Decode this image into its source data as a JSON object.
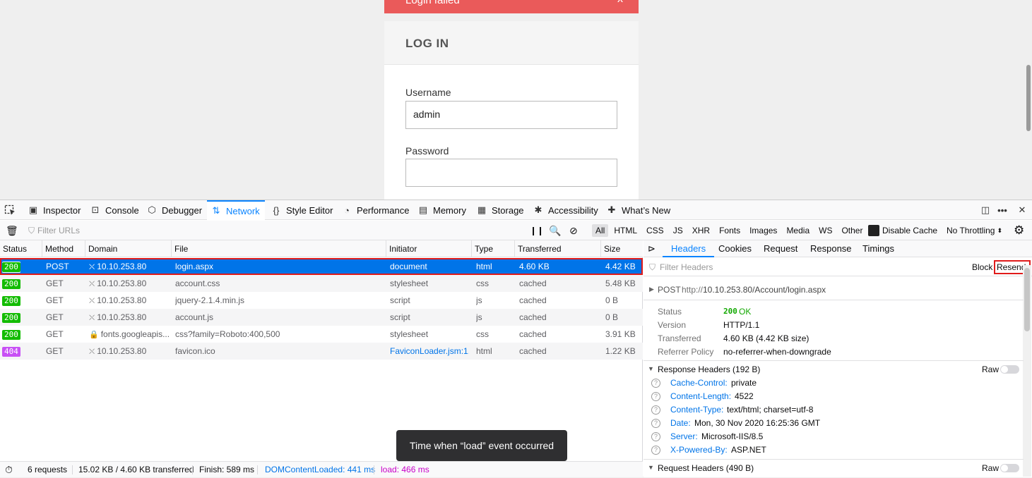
{
  "page": {
    "alert_text": "Login failed",
    "alert_close": "x",
    "login_title": "LOG IN",
    "username_label": "Username",
    "username_value": "admin",
    "password_label": "Password",
    "password_value": ""
  },
  "devtools": {
    "tabs": [
      "Inspector",
      "Console",
      "Debugger",
      "Network",
      "Style Editor",
      "Performance",
      "Memory",
      "Storage",
      "Accessibility",
      "What’s New"
    ],
    "active_tab": "Network",
    "filter_placeholder": "Filter URLs",
    "type_filters": [
      "All",
      "HTML",
      "CSS",
      "JS",
      "XHR",
      "Fonts",
      "Images",
      "Media",
      "WS",
      "Other"
    ],
    "disable_cache": "Disable Cache",
    "throttling": "No Throttling",
    "columns": [
      "Status",
      "Method",
      "Domain",
      "File",
      "Initiator",
      "Type",
      "Transferred",
      "Size"
    ],
    "requests": [
      {
        "status": "200",
        "method": "POST",
        "domain": "10.10.253.80",
        "file": "login.aspx",
        "initiator": "document",
        "type": "html",
        "transferred": "4.60 KB",
        "size": "4.42 KB"
      },
      {
        "status": "200",
        "method": "GET",
        "domain": "10.10.253.80",
        "file": "account.css",
        "initiator": "stylesheet",
        "type": "css",
        "transferred": "cached",
        "size": "5.48 KB"
      },
      {
        "status": "200",
        "method": "GET",
        "domain": "10.10.253.80",
        "file": "jquery-2.1.4.min.js",
        "initiator": "script",
        "type": "js",
        "transferred": "cached",
        "size": "0 B"
      },
      {
        "status": "200",
        "method": "GET",
        "domain": "10.10.253.80",
        "file": "account.js",
        "initiator": "script",
        "type": "js",
        "transferred": "cached",
        "size": "0 B"
      },
      {
        "status": "200",
        "method": "GET",
        "domain": "fonts.googleapis...",
        "file": "css?family=Roboto:400,500",
        "initiator": "stylesheet",
        "type": "css",
        "transferred": "cached",
        "size": "3.91 KB"
      },
      {
        "status": "404",
        "method": "GET",
        "domain": "10.10.253.80",
        "file": "favicon.ico",
        "initiator": "FaviconLoader.jsm:1...",
        "type": "html",
        "transferred": "cached",
        "size": "1.22 KB"
      }
    ],
    "tooltip": "Time when “load” event occurred",
    "statusbar": {
      "requests": "6 requests",
      "transferred": "15.02 KB / 4.60 KB transferred",
      "finish": "Finish: 589 ms",
      "dcl": "DOMContentLoaded: 441 ms",
      "load": "load: 466 ms"
    },
    "side": {
      "tabs": [
        "Headers",
        "Cookies",
        "Request",
        "Response",
        "Timings"
      ],
      "active_tab": "Headers",
      "filter_placeholder": "Filter Headers",
      "block": "Block",
      "resend": "Resend",
      "summary_method": "POST",
      "summary_url_scheme": "http://",
      "summary_url_rest": "10.10.253.80/Account/login.aspx",
      "status_label": "Status",
      "status_code": "200",
      "status_text": "OK",
      "version_label": "Version",
      "version_value": "HTTP/1.1",
      "transferred_label": "Transferred",
      "transferred_value": "4.60 KB (4.42 KB size)",
      "referrer_label": "Referrer Policy",
      "referrer_value": "no-referrer-when-downgrade",
      "response_headers_title": "Response Headers (192 B)",
      "raw": "Raw",
      "response_headers": [
        {
          "name": "Cache-Control:",
          "value": "private"
        },
        {
          "name": "Content-Length:",
          "value": "4522"
        },
        {
          "name": "Content-Type:",
          "value": "text/html; charset=utf-8"
        },
        {
          "name": "Date:",
          "value": "Mon, 30 Nov 2020 16:25:36 GMT"
        },
        {
          "name": "Server:",
          "value": "Microsoft-IIS/8.5"
        },
        {
          "name": "X-Powered-By:",
          "value": "ASP.NET"
        }
      ],
      "request_headers_title": "Request Headers (490 B)"
    }
  },
  "colors": {
    "accent": "#0a84ff",
    "selected_row": "#0074e8",
    "status_ok": "#12bc00",
    "status_404": "#c851f5",
    "highlight_outline": "#e01b1b",
    "alert_bg": "#ea5a5a"
  }
}
